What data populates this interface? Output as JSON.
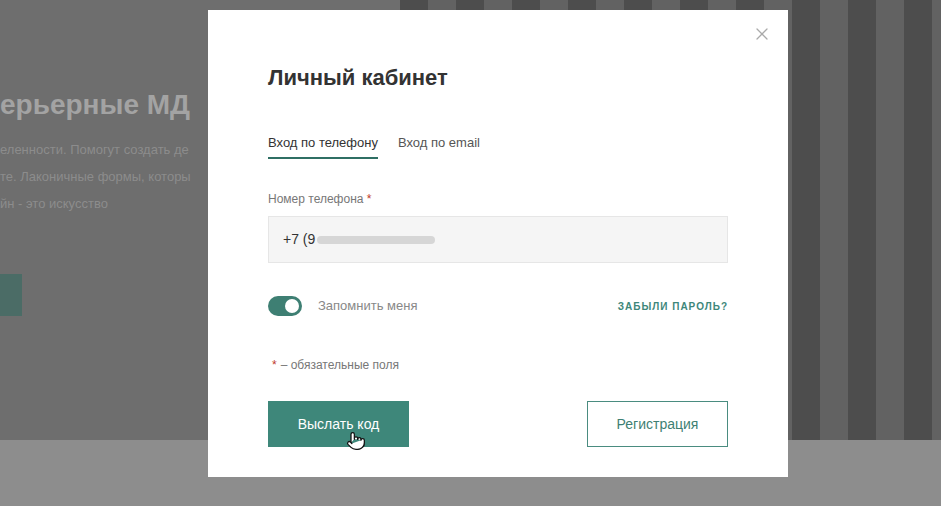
{
  "background": {
    "heading": "ерьерные МД",
    "lines": [
      "еленности. Помогут создать де",
      "те. Лаконичные формы, которы",
      "йн - это искусство"
    ]
  },
  "dialog": {
    "title": "Личный кабинет",
    "tabs": [
      {
        "label": "Вход по телефону",
        "selected": true
      },
      {
        "label": "Вход по email",
        "selected": false
      }
    ],
    "phone_field": {
      "label": "Номер телефона",
      "required_mark": "*",
      "value": "+7 (9",
      "masked": true
    },
    "remember_me": {
      "label": "Запомнить меня",
      "on": true
    },
    "forgot_password": "ЗАБЫЛИ ПАРОЛЬ?",
    "required_note": {
      "mark": "*",
      "text": "– обязательные поля"
    },
    "buttons": [
      {
        "label": "Выслать код",
        "kind": "primary"
      },
      {
        "label": "Регистрация",
        "kind": "secondary"
      }
    ]
  }
}
